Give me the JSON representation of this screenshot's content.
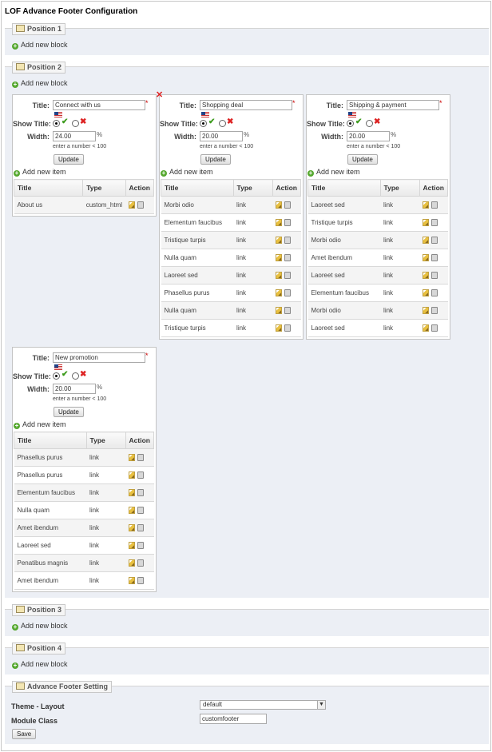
{
  "page_title": "LOF Advance Footer Configuration",
  "add_block_label": "Add new block",
  "add_item_label": "Add new item",
  "form": {
    "title_label": "Title:",
    "show_title_label": "Show Title:",
    "width_label": "Width:",
    "percent": "%",
    "width_hint": "enter a number < 100",
    "update_label": "Update",
    "required_mark": "*"
  },
  "table_headers": {
    "title": "Title",
    "type": "Type",
    "action": "Action"
  },
  "positions": [
    {
      "legend": "Position 1"
    },
    {
      "legend": "Position 2"
    },
    {
      "legend": "Position 3"
    },
    {
      "legend": "Position 4"
    }
  ],
  "blocks": [
    {
      "title": "Connect with us",
      "width": "24.00",
      "show_title": true,
      "items": [
        {
          "title": "About us",
          "type": "custom_html"
        }
      ]
    },
    {
      "title": "Shopping deal",
      "width": "20.00",
      "show_title": true,
      "items": [
        {
          "title": "Morbi odio",
          "type": "link"
        },
        {
          "title": "Elementum faucibus",
          "type": "link"
        },
        {
          "title": "Tristique turpis",
          "type": "link"
        },
        {
          "title": "Nulla quam",
          "type": "link"
        },
        {
          "title": "Laoreet sed",
          "type": "link"
        },
        {
          "title": "Phasellus purus",
          "type": "link"
        },
        {
          "title": "Nulla quam",
          "type": "link"
        },
        {
          "title": "Tristique turpis",
          "type": "link"
        }
      ]
    },
    {
      "title": "Shipping & payment",
      "width": "20.00",
      "show_title": true,
      "items": [
        {
          "title": "Laoreet sed",
          "type": "link"
        },
        {
          "title": "Tristique turpis",
          "type": "link"
        },
        {
          "title": "Morbi odio",
          "type": "link"
        },
        {
          "title": "Amet ibendum",
          "type": "link"
        },
        {
          "title": "Laoreet sed",
          "type": "link"
        },
        {
          "title": "Elementum faucibus",
          "type": "link"
        },
        {
          "title": "Morbi odio",
          "type": "link"
        },
        {
          "title": "Laoreet sed",
          "type": "link"
        }
      ]
    },
    {
      "title": "New promotion",
      "width": "20.00",
      "show_title": true,
      "items": [
        {
          "title": "Phasellus purus",
          "type": "link"
        },
        {
          "title": "Phasellus purus",
          "type": "link"
        },
        {
          "title": "Elementum faucibus",
          "type": "link"
        },
        {
          "title": "Nulla quam",
          "type": "link"
        },
        {
          "title": "Amet ibendum",
          "type": "link"
        },
        {
          "title": "Laoreet sed",
          "type": "link"
        },
        {
          "title": "Penatibus magnis",
          "type": "link"
        },
        {
          "title": "Amet ibendum",
          "type": "link"
        }
      ]
    }
  ],
  "settings": {
    "legend": "Advance Footer Setting",
    "theme_layout_label": "Theme - Layout",
    "theme_layout_value": "default",
    "module_class_label": "Module Class",
    "module_class_value": "customfooter",
    "save_label": "Save"
  },
  "colors": {
    "accent_green": "#55a82f",
    "delete_red": "#d22222",
    "section_bg": "#eceff5"
  }
}
